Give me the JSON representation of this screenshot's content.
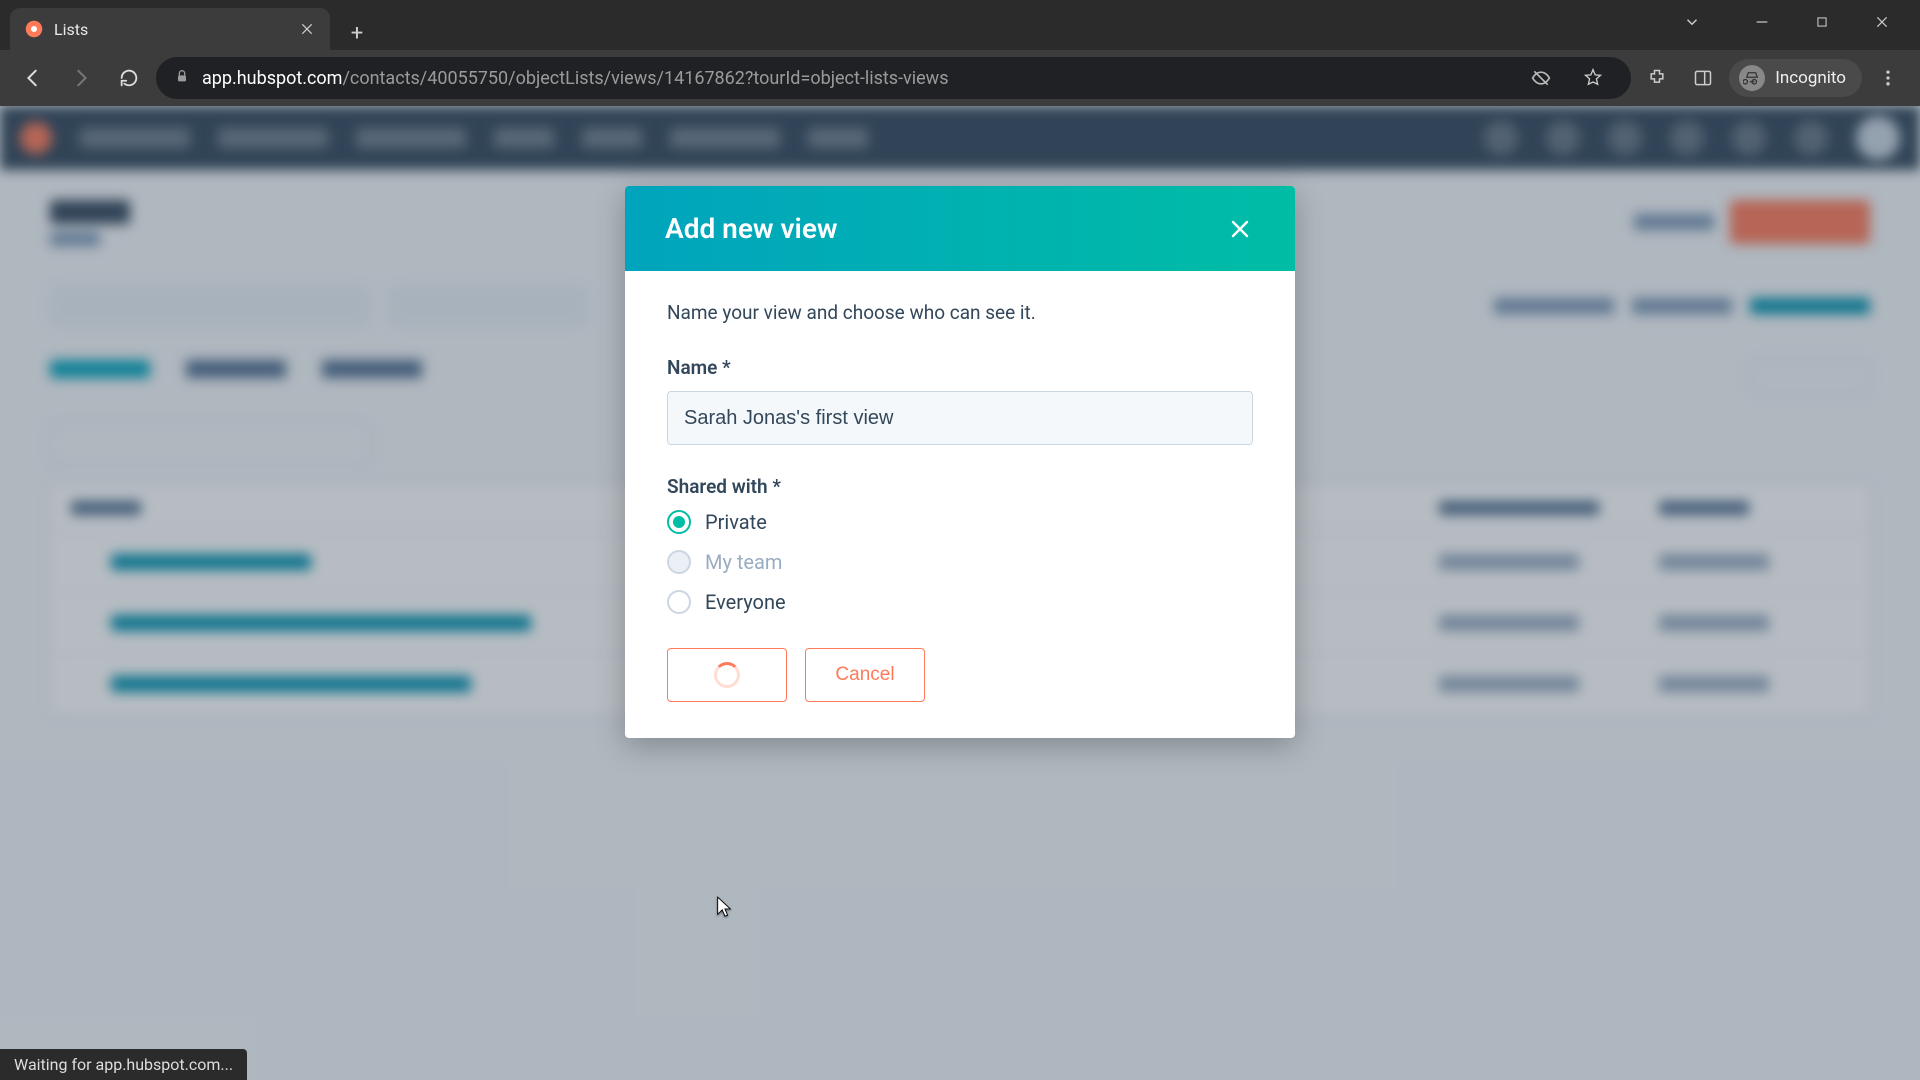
{
  "browser": {
    "tab_title": "Lists",
    "url_domain": "app.hubspot.com",
    "url_path": "/contacts/40055750/objectLists/views/14167862?tourId=object-lists-views",
    "incognito_label": "Incognito",
    "status_text": "Waiting for app.hubspot.com..."
  },
  "modal": {
    "title": "Add new view",
    "description": "Name your view and choose who can see it.",
    "name_label": "Name *",
    "name_value": "Sarah Jonas's first view",
    "shared_label": "Shared with *",
    "options": {
      "private": "Private",
      "my_team": "My team",
      "everyone": "Everyone"
    },
    "cancel_label": "Cancel"
  },
  "colors": {
    "accent_teal": "#00bda5",
    "accent_orange": "#ff7a59",
    "text_dark": "#33475b"
  }
}
